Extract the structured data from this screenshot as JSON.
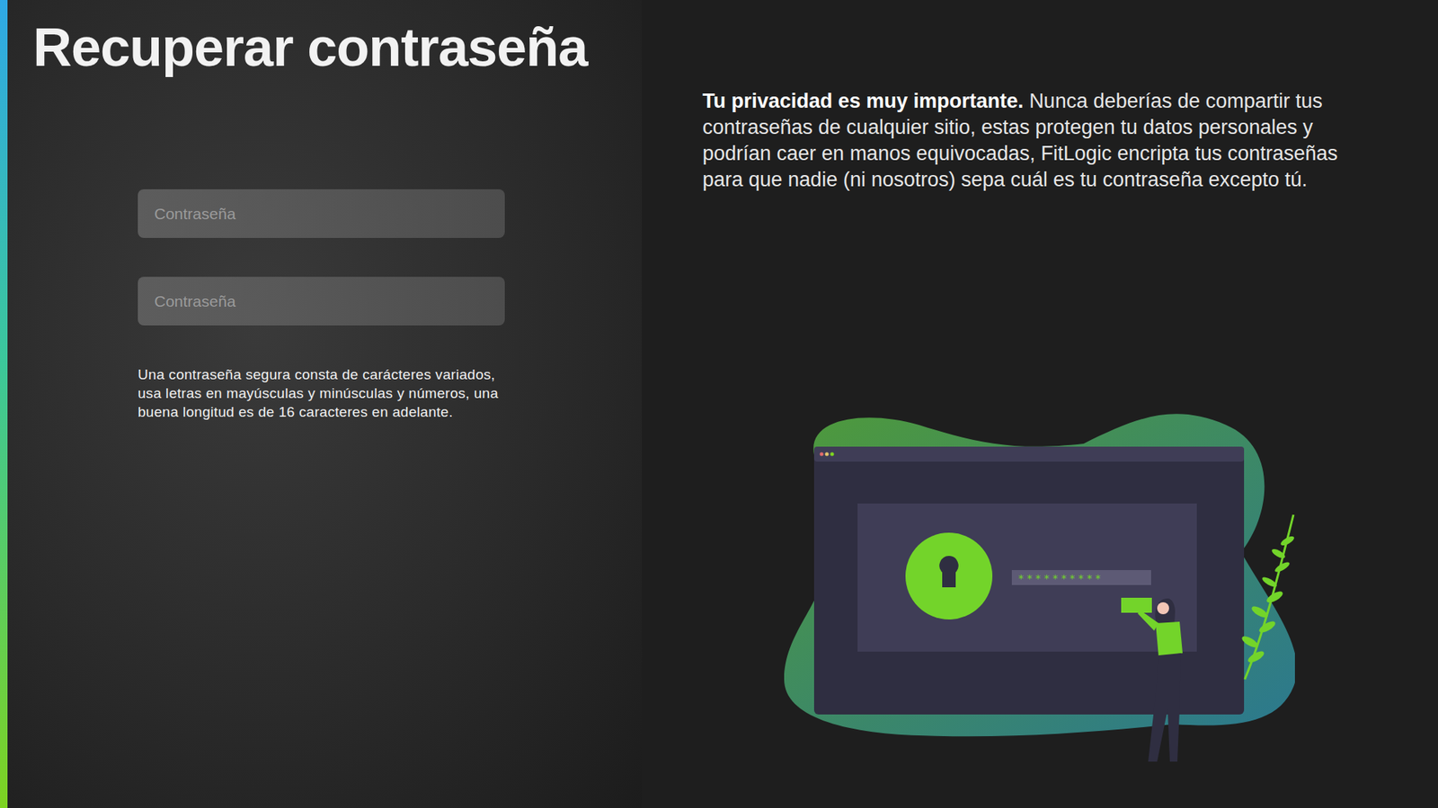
{
  "page": {
    "title": "Recuperar contraseña"
  },
  "fields": [
    {
      "placeholder": "Contraseña"
    },
    {
      "placeholder": "Contraseña"
    }
  ],
  "hint": "Una contraseña segura consta de carácteres variados, usa letras en mayúsculas y minúsculas y números, una buena longitud es de 16 caracteres en adelante.",
  "privacy": {
    "heading": "Tu privacidad es muy importante.",
    "body": "Nunca deberías de compartir tus contraseñas de cualquier sitio, estas protegen tu datos personales y podrían caer en manos equivocadas, FitLogic encripta tus contraseñas para que nadie (ni nosotros) sepa cuál es tu contraseña excepto tú."
  },
  "illustration": {
    "mask": "**********"
  }
}
